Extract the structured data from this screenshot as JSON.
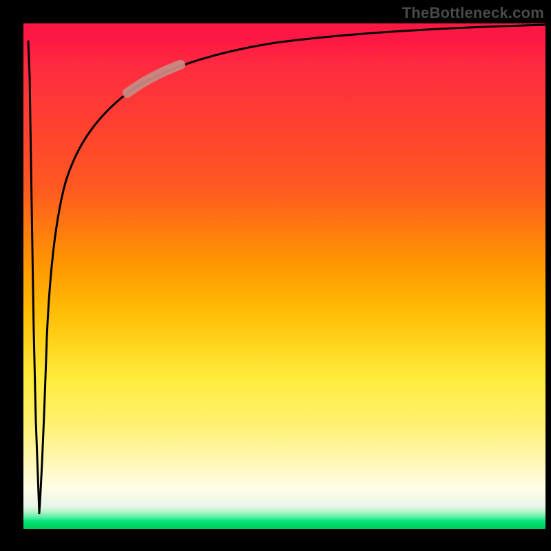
{
  "watermark": "TheBottleneck.com",
  "colors": {
    "curve": "#000000",
    "highlight": "#c88c84",
    "frame": "#000000"
  },
  "chart_data": {
    "type": "line",
    "title": "",
    "xlabel": "",
    "ylabel": "",
    "xlim": [
      0,
      100
    ],
    "ylim": [
      0,
      100
    ],
    "grid": false,
    "series": [
      {
        "name": "bottleneck-curve",
        "x": [
          0.0,
          0.3,
          0.7,
          1.0,
          1.3,
          1.8,
          2.5,
          3.3,
          4.5,
          6.0,
          8.0,
          11.0,
          15.0,
          20.0,
          27.0,
          35.0,
          45.0,
          58.0,
          72.0,
          86.0,
          100.0
        ],
        "values": [
          96.5,
          89.0,
          72.0,
          55.0,
          38.0,
          18.0,
          3.0,
          18.0,
          38.0,
          55.0,
          68.0,
          77.0,
          83.0,
          87.0,
          90.0,
          92.0,
          93.3,
          94.3,
          95.0,
          95.4,
          95.7
        ]
      }
    ],
    "annotations": [
      {
        "name": "highlight-segment",
        "x_range": [
          20.0,
          30.0
        ],
        "description": "salmon highlight on curve"
      }
    ],
    "background_gradient": [
      {
        "pos": 0.0,
        "color": "#ff1744"
      },
      {
        "pos": 0.32,
        "color": "#ff5722"
      },
      {
        "pos": 0.58,
        "color": "#ffc107"
      },
      {
        "pos": 0.8,
        "color": "#fff176"
      },
      {
        "pos": 0.96,
        "color": "#b9f6ca"
      },
      {
        "pos": 1.0,
        "color": "#00c853"
      }
    ]
  }
}
